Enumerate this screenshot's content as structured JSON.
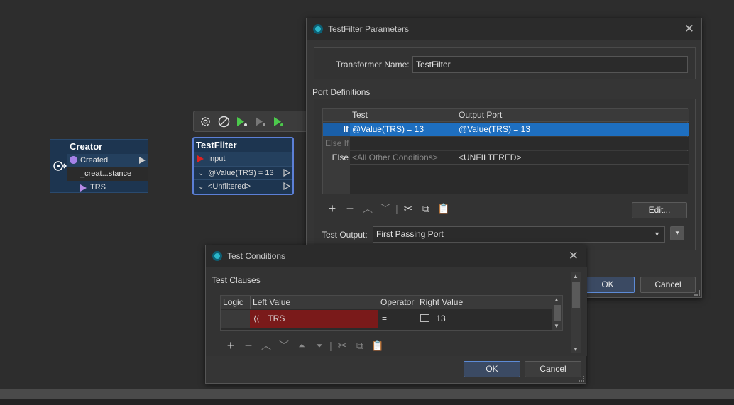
{
  "canvas": {
    "creator": {
      "title": "Creator",
      "ports": [
        "Created",
        "_creat...stance",
        "TRS"
      ]
    },
    "testfilter": {
      "title": "TestFilter",
      "input_label": "Input",
      "outputs": [
        "@Value(TRS) = 13",
        "<Unfiltered>"
      ]
    },
    "toolbar": {
      "icons": [
        "gear-icon",
        "disable-icon",
        "run-to-icon",
        "run-from-icon",
        "run-icon"
      ]
    }
  },
  "params_dialog": {
    "title": "TestFilter Parameters",
    "transformer_name_label": "Transformer Name:",
    "transformer_name_value": "TestFilter",
    "port_definitions_label": "Port Definitions",
    "columns": [
      "Test",
      "Output Port"
    ],
    "rows": [
      {
        "label": "If",
        "test": "@Value(TRS) = 13",
        "output": "@Value(TRS) = 13"
      },
      {
        "label": "Else If",
        "test": "",
        "output": ""
      },
      {
        "label": "Else",
        "test": "<All Other Conditions>",
        "output": "<UNFILTERED>"
      }
    ],
    "edit_label": "Edit...",
    "test_output_label": "Test Output:",
    "test_output_value": "First Passing Port",
    "ok_label": "OK",
    "cancel_label": "Cancel"
  },
  "conditions_dialog": {
    "title": "Test Conditions",
    "clauses_label": "Test Clauses",
    "columns": [
      "Logic",
      "Left Value",
      "Operator",
      "Right Value"
    ],
    "row": {
      "logic": "",
      "left": "TRS",
      "operator": "=",
      "right": "13"
    },
    "ok_label": "OK",
    "cancel_label": "Cancel"
  },
  "colors": {
    "selected_row": "#1e6fc0",
    "left_value_bg": "#7a1a1a",
    "node_bg": "#1d3550",
    "node_selected_border": "#5c7fd6"
  }
}
